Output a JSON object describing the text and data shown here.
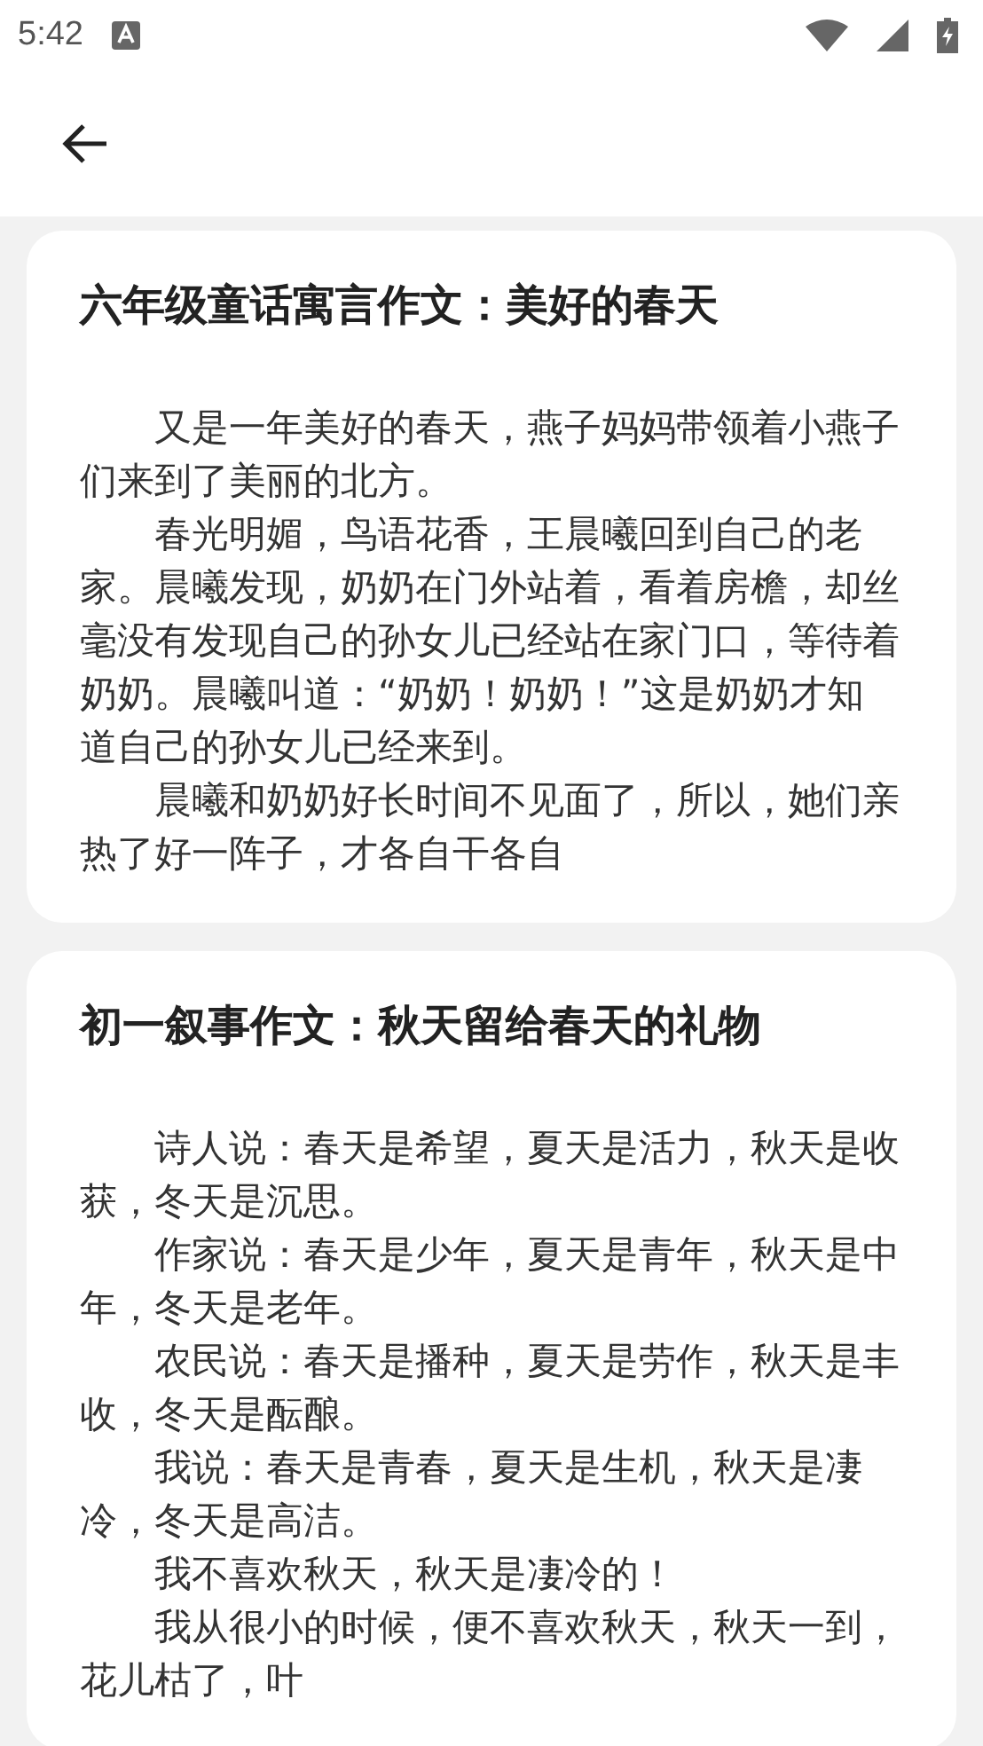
{
  "status_bar": {
    "time": "5:42"
  },
  "articles": [
    {
      "title": "六年级童话寓言作文：美好的春天",
      "paragraphs": [
        "又是一年美好的春天，燕子妈妈带领着小燕子们来到了美丽的北方。",
        "春光明媚，鸟语花香，王晨曦回到自己的老家。晨曦发现，奶奶在门外站着，看着房檐，却丝毫没有发现自己的孙女儿已经站在家门口，等待着奶奶。晨曦叫道：“奶奶！奶奶！”这是奶奶才知道自己的孙女儿已经来到。",
        "晨曦和奶奶好长时间不见面了，所以，她们亲热了好一阵子，才各自干各自"
      ]
    },
    {
      "title": "初一叙事作文：秋天留给春天的礼物",
      "paragraphs": [
        "诗人说：春天是希望，夏天是活力，秋天是收获，冬天是沉思。",
        "作家说：春天是少年，夏天是青年，秋天是中年，冬天是老年。",
        "农民说：春天是播种，夏天是劳作，秋天是丰收，冬天是酝酿。",
        "我说：春天是青春，夏天是生机，秋天是凄冷，冬天是高洁。",
        "我不喜欢秋天，秋天是凄冷的！",
        "我从很小的时候，便不喜欢秋天，秋天一到，花儿枯了，叶"
      ]
    }
  ]
}
